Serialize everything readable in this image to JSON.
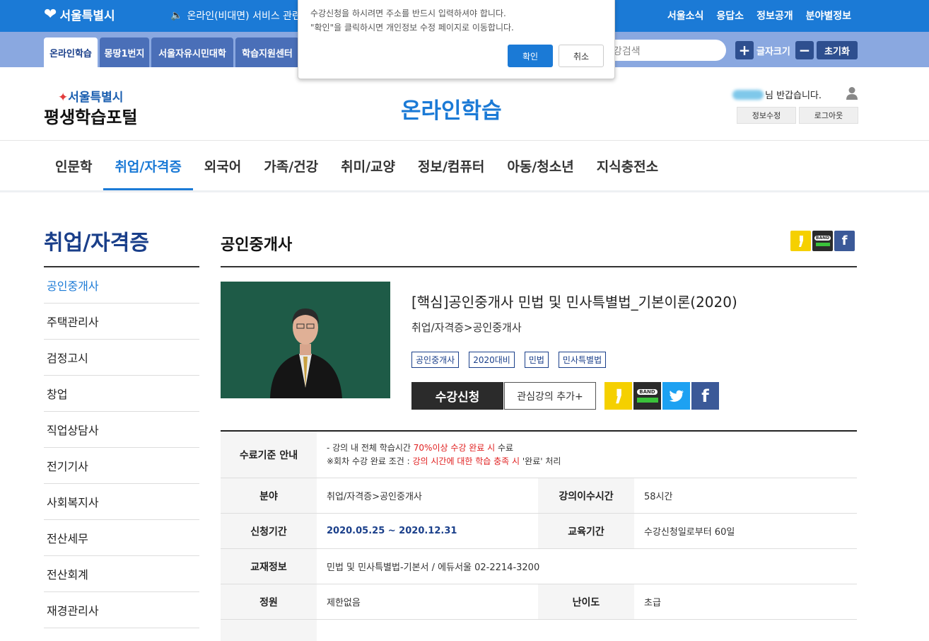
{
  "topbar": {
    "logo": "서울특별시",
    "notice": "온라인(비대면) 서비스 관련 ...",
    "links": [
      "서울소식",
      "응답소",
      "정보공개",
      "분야별정보"
    ]
  },
  "subbar": {
    "tabs": [
      "온라인학습",
      "몽땅1번지",
      "서울자유시민대학",
      "학습지원센터"
    ],
    "search_placeholder": "강검색",
    "font_plus": "+",
    "font_label": "글자크기",
    "font_minus": "−",
    "reset": "초기화"
  },
  "header": {
    "city": "서울특별시",
    "portal": "평생학습포털",
    "title": "온라인학습",
    "greeting": "님 반갑습니다.",
    "edit_info": "정보수정",
    "logout": "로그아웃"
  },
  "mainnav": [
    "인문학",
    "취업/자격증",
    "외국어",
    "가족/건강",
    "취미/교양",
    "정보/컴퓨터",
    "아동/청소년",
    "지식충전소"
  ],
  "mainnav_active": 1,
  "sidebar": {
    "title": "취업/자격증",
    "items": [
      "공인중개사",
      "주택관리사",
      "검정고시",
      "창업",
      "직업상담사",
      "전기기사",
      "사회복지사",
      "전산세무",
      "전산회계",
      "재경관리사"
    ],
    "active": 0
  },
  "content": {
    "title": "공인중개사",
    "course_title": "[핵심]공인중개사 민법 및 민사특별법_기본이론(2020)",
    "category": "취업/자격증>공인중개사",
    "tags": [
      "공인중개사",
      "2020대비",
      "민법",
      "민사특별법"
    ],
    "enroll": "수강신청",
    "add_fav": "관심강의 추가+",
    "share": {
      "kakao": "kakaostory-icon",
      "band": "band-icon",
      "twitter": "twitter-icon",
      "facebook": "facebook-icon"
    },
    "band_text": "BAND",
    "fb_text": "f"
  },
  "info": {
    "completion_label": "수료기준 안내",
    "completion_line1_a": "- 강의 내 전체 학습시간 ",
    "completion_line1_b": "70%이상 수강 완료 시",
    "completion_line1_c": " 수료",
    "completion_line2_a": "※회차 수강 완료 조건 : ",
    "completion_line2_b": "강의 시간에 대한 학습 충족 시",
    "completion_line2_c": " '완료' 처리",
    "field_label": "분야",
    "field_value": "취업/자격증>공인중개사",
    "hours_label": "강의이수시간",
    "hours_value": "58시간",
    "apply_label": "신청기간",
    "apply_value": "2020.05.25 ~ 2020.12.31",
    "edu_label": "교육기간",
    "edu_value": "수강신청일로부터 60일",
    "book_label": "교재정보",
    "book_value": "민법 및 민사특별법-기본서 / 에듀서울 02-2214-3200",
    "cap_label": "정원",
    "cap_value": "제한없음",
    "level_label": "난이도",
    "level_value": "초급"
  },
  "modal": {
    "line1": "수강신청을 하시려면 주소를 반드시 입력하셔야 합니다.",
    "line2": "\"확인\"을 클릭하시면 개인정보 수정 페이지로 이동합니다.",
    "ok": "확인",
    "cancel": "취소"
  },
  "colors": {
    "primary": "#1b7ad6",
    "navy": "#1a3f8a",
    "highlight": "#e02020"
  }
}
